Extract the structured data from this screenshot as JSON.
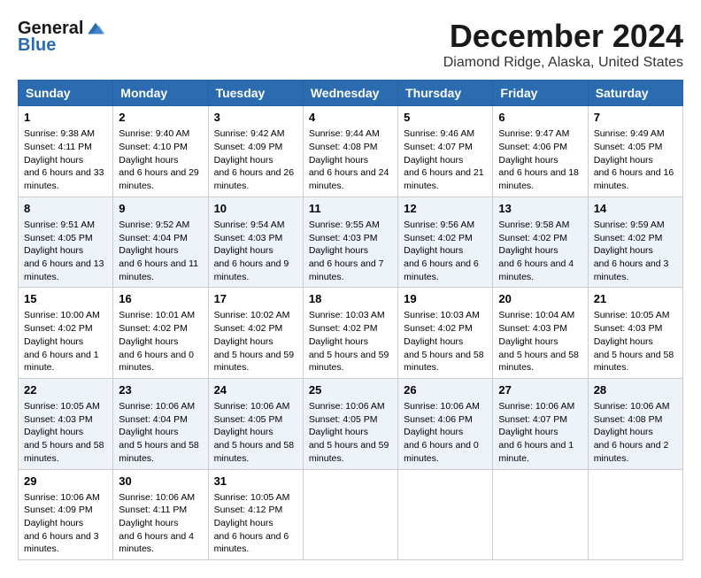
{
  "header": {
    "logo_line1": "General",
    "logo_line2": "Blue",
    "month": "December 2024",
    "location": "Diamond Ridge, Alaska, United States"
  },
  "weekdays": [
    "Sunday",
    "Monday",
    "Tuesday",
    "Wednesday",
    "Thursday",
    "Friday",
    "Saturday"
  ],
  "weeks": [
    [
      {
        "day": "1",
        "sunrise": "9:38 AM",
        "sunset": "4:11 PM",
        "daylight": "6 hours and 33 minutes."
      },
      {
        "day": "2",
        "sunrise": "9:40 AM",
        "sunset": "4:10 PM",
        "daylight": "6 hours and 29 minutes."
      },
      {
        "day": "3",
        "sunrise": "9:42 AM",
        "sunset": "4:09 PM",
        "daylight": "6 hours and 26 minutes."
      },
      {
        "day": "4",
        "sunrise": "9:44 AM",
        "sunset": "4:08 PM",
        "daylight": "6 hours and 24 minutes."
      },
      {
        "day": "5",
        "sunrise": "9:46 AM",
        "sunset": "4:07 PM",
        "daylight": "6 hours and 21 minutes."
      },
      {
        "day": "6",
        "sunrise": "9:47 AM",
        "sunset": "4:06 PM",
        "daylight": "6 hours and 18 minutes."
      },
      {
        "day": "7",
        "sunrise": "9:49 AM",
        "sunset": "4:05 PM",
        "daylight": "6 hours and 16 minutes."
      }
    ],
    [
      {
        "day": "8",
        "sunrise": "9:51 AM",
        "sunset": "4:05 PM",
        "daylight": "6 hours and 13 minutes."
      },
      {
        "day": "9",
        "sunrise": "9:52 AM",
        "sunset": "4:04 PM",
        "daylight": "6 hours and 11 minutes."
      },
      {
        "day": "10",
        "sunrise": "9:54 AM",
        "sunset": "4:03 PM",
        "daylight": "6 hours and 9 minutes."
      },
      {
        "day": "11",
        "sunrise": "9:55 AM",
        "sunset": "4:03 PM",
        "daylight": "6 hours and 7 minutes."
      },
      {
        "day": "12",
        "sunrise": "9:56 AM",
        "sunset": "4:02 PM",
        "daylight": "6 hours and 6 minutes."
      },
      {
        "day": "13",
        "sunrise": "9:58 AM",
        "sunset": "4:02 PM",
        "daylight": "6 hours and 4 minutes."
      },
      {
        "day": "14",
        "sunrise": "9:59 AM",
        "sunset": "4:02 PM",
        "daylight": "6 hours and 3 minutes."
      }
    ],
    [
      {
        "day": "15",
        "sunrise": "10:00 AM",
        "sunset": "4:02 PM",
        "daylight": "6 hours and 1 minute."
      },
      {
        "day": "16",
        "sunrise": "10:01 AM",
        "sunset": "4:02 PM",
        "daylight": "6 hours and 0 minutes."
      },
      {
        "day": "17",
        "sunrise": "10:02 AM",
        "sunset": "4:02 PM",
        "daylight": "5 hours and 59 minutes."
      },
      {
        "day": "18",
        "sunrise": "10:03 AM",
        "sunset": "4:02 PM",
        "daylight": "5 hours and 59 minutes."
      },
      {
        "day": "19",
        "sunrise": "10:03 AM",
        "sunset": "4:02 PM",
        "daylight": "5 hours and 58 minutes."
      },
      {
        "day": "20",
        "sunrise": "10:04 AM",
        "sunset": "4:03 PM",
        "daylight": "5 hours and 58 minutes."
      },
      {
        "day": "21",
        "sunrise": "10:05 AM",
        "sunset": "4:03 PM",
        "daylight": "5 hours and 58 minutes."
      }
    ],
    [
      {
        "day": "22",
        "sunrise": "10:05 AM",
        "sunset": "4:03 PM",
        "daylight": "5 hours and 58 minutes."
      },
      {
        "day": "23",
        "sunrise": "10:06 AM",
        "sunset": "4:04 PM",
        "daylight": "5 hours and 58 minutes."
      },
      {
        "day": "24",
        "sunrise": "10:06 AM",
        "sunset": "4:05 PM",
        "daylight": "5 hours and 58 minutes."
      },
      {
        "day": "25",
        "sunrise": "10:06 AM",
        "sunset": "4:05 PM",
        "daylight": "5 hours and 59 minutes."
      },
      {
        "day": "26",
        "sunrise": "10:06 AM",
        "sunset": "4:06 PM",
        "daylight": "6 hours and 0 minutes."
      },
      {
        "day": "27",
        "sunrise": "10:06 AM",
        "sunset": "4:07 PM",
        "daylight": "6 hours and 1 minute."
      },
      {
        "day": "28",
        "sunrise": "10:06 AM",
        "sunset": "4:08 PM",
        "daylight": "6 hours and 2 minutes."
      }
    ],
    [
      {
        "day": "29",
        "sunrise": "10:06 AM",
        "sunset": "4:09 PM",
        "daylight": "6 hours and 3 minutes."
      },
      {
        "day": "30",
        "sunrise": "10:06 AM",
        "sunset": "4:11 PM",
        "daylight": "6 hours and 4 minutes."
      },
      {
        "day": "31",
        "sunrise": "10:05 AM",
        "sunset": "4:12 PM",
        "daylight": "6 hours and 6 minutes."
      },
      null,
      null,
      null,
      null
    ]
  ],
  "labels": {
    "sunrise": "Sunrise:",
    "sunset": "Sunset:",
    "daylight": "Daylight hours"
  }
}
